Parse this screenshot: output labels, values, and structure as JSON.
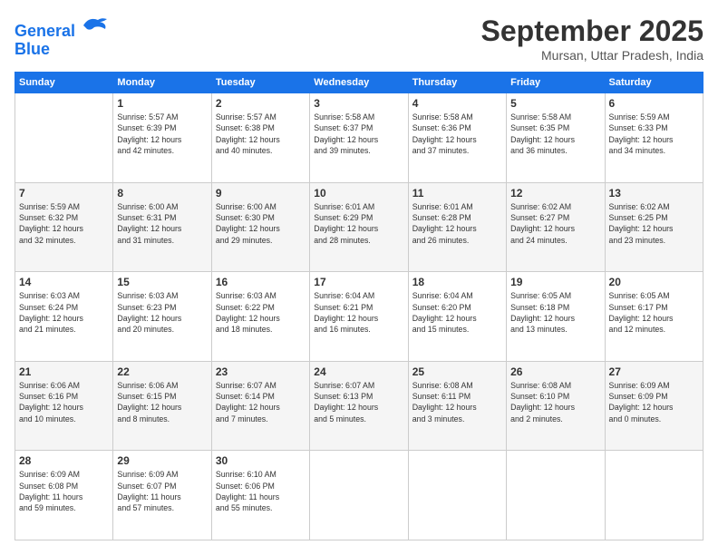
{
  "logo": {
    "line1": "General",
    "line2": "Blue"
  },
  "title": "September 2025",
  "subtitle": "Mursan, Uttar Pradesh, India",
  "weekdays": [
    "Sunday",
    "Monday",
    "Tuesday",
    "Wednesday",
    "Thursday",
    "Friday",
    "Saturday"
  ],
  "weeks": [
    [
      {
        "day": "",
        "info": ""
      },
      {
        "day": "1",
        "info": "Sunrise: 5:57 AM\nSunset: 6:39 PM\nDaylight: 12 hours\nand 42 minutes."
      },
      {
        "day": "2",
        "info": "Sunrise: 5:57 AM\nSunset: 6:38 PM\nDaylight: 12 hours\nand 40 minutes."
      },
      {
        "day": "3",
        "info": "Sunrise: 5:58 AM\nSunset: 6:37 PM\nDaylight: 12 hours\nand 39 minutes."
      },
      {
        "day": "4",
        "info": "Sunrise: 5:58 AM\nSunset: 6:36 PM\nDaylight: 12 hours\nand 37 minutes."
      },
      {
        "day": "5",
        "info": "Sunrise: 5:58 AM\nSunset: 6:35 PM\nDaylight: 12 hours\nand 36 minutes."
      },
      {
        "day": "6",
        "info": "Sunrise: 5:59 AM\nSunset: 6:33 PM\nDaylight: 12 hours\nand 34 minutes."
      }
    ],
    [
      {
        "day": "7",
        "info": "Sunrise: 5:59 AM\nSunset: 6:32 PM\nDaylight: 12 hours\nand 32 minutes."
      },
      {
        "day": "8",
        "info": "Sunrise: 6:00 AM\nSunset: 6:31 PM\nDaylight: 12 hours\nand 31 minutes."
      },
      {
        "day": "9",
        "info": "Sunrise: 6:00 AM\nSunset: 6:30 PM\nDaylight: 12 hours\nand 29 minutes."
      },
      {
        "day": "10",
        "info": "Sunrise: 6:01 AM\nSunset: 6:29 PM\nDaylight: 12 hours\nand 28 minutes."
      },
      {
        "day": "11",
        "info": "Sunrise: 6:01 AM\nSunset: 6:28 PM\nDaylight: 12 hours\nand 26 minutes."
      },
      {
        "day": "12",
        "info": "Sunrise: 6:02 AM\nSunset: 6:27 PM\nDaylight: 12 hours\nand 24 minutes."
      },
      {
        "day": "13",
        "info": "Sunrise: 6:02 AM\nSunset: 6:25 PM\nDaylight: 12 hours\nand 23 minutes."
      }
    ],
    [
      {
        "day": "14",
        "info": "Sunrise: 6:03 AM\nSunset: 6:24 PM\nDaylight: 12 hours\nand 21 minutes."
      },
      {
        "day": "15",
        "info": "Sunrise: 6:03 AM\nSunset: 6:23 PM\nDaylight: 12 hours\nand 20 minutes."
      },
      {
        "day": "16",
        "info": "Sunrise: 6:03 AM\nSunset: 6:22 PM\nDaylight: 12 hours\nand 18 minutes."
      },
      {
        "day": "17",
        "info": "Sunrise: 6:04 AM\nSunset: 6:21 PM\nDaylight: 12 hours\nand 16 minutes."
      },
      {
        "day": "18",
        "info": "Sunrise: 6:04 AM\nSunset: 6:20 PM\nDaylight: 12 hours\nand 15 minutes."
      },
      {
        "day": "19",
        "info": "Sunrise: 6:05 AM\nSunset: 6:18 PM\nDaylight: 12 hours\nand 13 minutes."
      },
      {
        "day": "20",
        "info": "Sunrise: 6:05 AM\nSunset: 6:17 PM\nDaylight: 12 hours\nand 12 minutes."
      }
    ],
    [
      {
        "day": "21",
        "info": "Sunrise: 6:06 AM\nSunset: 6:16 PM\nDaylight: 12 hours\nand 10 minutes."
      },
      {
        "day": "22",
        "info": "Sunrise: 6:06 AM\nSunset: 6:15 PM\nDaylight: 12 hours\nand 8 minutes."
      },
      {
        "day": "23",
        "info": "Sunrise: 6:07 AM\nSunset: 6:14 PM\nDaylight: 12 hours\nand 7 minutes."
      },
      {
        "day": "24",
        "info": "Sunrise: 6:07 AM\nSunset: 6:13 PM\nDaylight: 12 hours\nand 5 minutes."
      },
      {
        "day": "25",
        "info": "Sunrise: 6:08 AM\nSunset: 6:11 PM\nDaylight: 12 hours\nand 3 minutes."
      },
      {
        "day": "26",
        "info": "Sunrise: 6:08 AM\nSunset: 6:10 PM\nDaylight: 12 hours\nand 2 minutes."
      },
      {
        "day": "27",
        "info": "Sunrise: 6:09 AM\nSunset: 6:09 PM\nDaylight: 12 hours\nand 0 minutes."
      }
    ],
    [
      {
        "day": "28",
        "info": "Sunrise: 6:09 AM\nSunset: 6:08 PM\nDaylight: 11 hours\nand 59 minutes."
      },
      {
        "day": "29",
        "info": "Sunrise: 6:09 AM\nSunset: 6:07 PM\nDaylight: 11 hours\nand 57 minutes."
      },
      {
        "day": "30",
        "info": "Sunrise: 6:10 AM\nSunset: 6:06 PM\nDaylight: 11 hours\nand 55 minutes."
      },
      {
        "day": "",
        "info": ""
      },
      {
        "day": "",
        "info": ""
      },
      {
        "day": "",
        "info": ""
      },
      {
        "day": "",
        "info": ""
      }
    ]
  ]
}
